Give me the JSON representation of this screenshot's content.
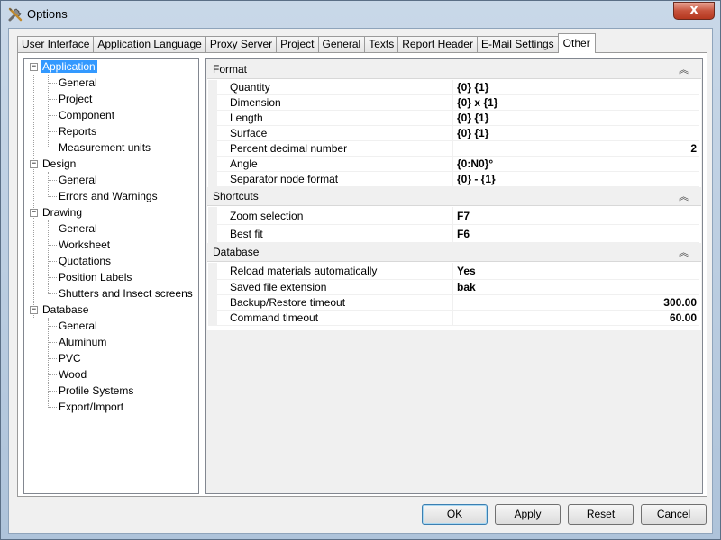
{
  "window": {
    "title": "Options",
    "close_glyph": "x"
  },
  "tabs": [
    {
      "label": "User Interface"
    },
    {
      "label": "Application Language"
    },
    {
      "label": "Proxy Server"
    },
    {
      "label": "Project"
    },
    {
      "label": "General"
    },
    {
      "label": "Texts"
    },
    {
      "label": "Report Header"
    },
    {
      "label": "E-Mail Settings"
    },
    {
      "label": "Other"
    }
  ],
  "active_tab": "Other",
  "tree": {
    "groups": [
      {
        "label": "Application",
        "expander": "−",
        "selected": true,
        "children": [
          "General",
          "Project",
          "Component",
          "Reports",
          "Measurement units"
        ]
      },
      {
        "label": "Design",
        "expander": "−",
        "children": [
          "General",
          "Errors and Warnings"
        ]
      },
      {
        "label": "Drawing",
        "expander": "−",
        "children": [
          "General",
          "Worksheet",
          "Quotations",
          "Position Labels",
          "Shutters and Insect screens"
        ]
      },
      {
        "label": "Database",
        "expander": "−",
        "children": [
          "General",
          "Aluminum",
          "PVC",
          "Wood",
          "Profile Systems",
          "Export/Import"
        ]
      }
    ]
  },
  "property_grid": {
    "collapse_glyph": "︽",
    "categories": [
      {
        "name": "Format",
        "properties": [
          {
            "name": "Quantity",
            "value": "{0} {1}"
          },
          {
            "name": "Dimension",
            "value": "{0} x {1}"
          },
          {
            "name": "Length",
            "value": "{0} {1}"
          },
          {
            "name": "Surface",
            "value": "{0} {1}"
          },
          {
            "name": "Percent decimal number",
            "value": "2",
            "align": "right"
          },
          {
            "name": "Angle",
            "value": "{0:N0}°"
          },
          {
            "name": "Separator node format",
            "value": "{0} - {1}"
          }
        ]
      },
      {
        "name": "Shortcuts",
        "properties": [
          {
            "name": "Zoom selection",
            "value": "F7"
          },
          {
            "name": "Best fit",
            "value": "F6"
          }
        ]
      },
      {
        "name": "Database",
        "properties": [
          {
            "name": "Reload materials automatically",
            "value": "Yes"
          },
          {
            "name": "Saved file extension",
            "value": "bak"
          },
          {
            "name": "Backup/Restore timeout",
            "value": "300.00",
            "align": "right"
          },
          {
            "name": "Command timeout",
            "value": "60.00",
            "align": "right"
          }
        ]
      }
    ]
  },
  "buttons": {
    "ok": "OK",
    "apply": "Apply",
    "reset": "Reset",
    "cancel": "Cancel"
  },
  "colors": {
    "selection": "#3399ff",
    "window_frame": "#aec3da"
  }
}
